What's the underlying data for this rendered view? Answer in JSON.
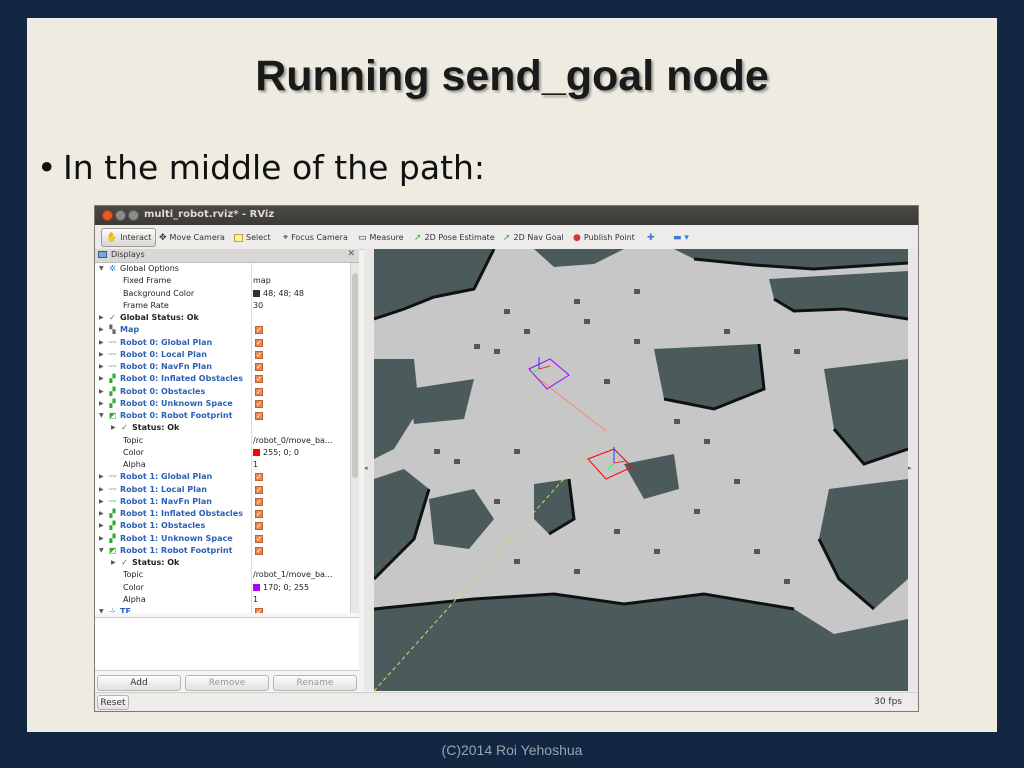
{
  "slide": {
    "title": "Running send_goal node",
    "bullet": "In the middle of the path:",
    "footer": "(C)2014 Roi Yehoshua"
  },
  "window": {
    "title": "multi_robot.rviz* - RViz"
  },
  "toolbar": {
    "interact": "Interact",
    "move_camera": "Move Camera",
    "select": "Select",
    "focus_camera": "Focus Camera",
    "measure": "Measure",
    "pose_estimate": "2D Pose Estimate",
    "nav_goal": "2D Nav Goal",
    "publish_point": "Publish Point"
  },
  "displays": {
    "title": "Displays",
    "rows": [
      {
        "name": "Global Options",
        "style": "normal"
      },
      {
        "name": "Fixed Frame",
        "value": "map"
      },
      {
        "name": "Background Color",
        "value": "48; 48; 48"
      },
      {
        "name": "Frame Rate",
        "value": "30"
      },
      {
        "name": "Global Status: Ok",
        "style": "bold"
      },
      {
        "name": "Map"
      },
      {
        "name": "Robot 0: Global Plan"
      },
      {
        "name": "Robot 0: Local Plan"
      },
      {
        "name": "Robot 0: NavFn Plan"
      },
      {
        "name": "Robot 0: Inflated Obstacles"
      },
      {
        "name": "Robot 0: Obstacles"
      },
      {
        "name": "Robot 0: Unknown Space"
      },
      {
        "name": "Robot 0: Robot Footprint"
      },
      {
        "name": "Status: Ok"
      },
      {
        "name": "Topic",
        "value": "/robot_0/move_ba..."
      },
      {
        "name": "Color",
        "value": "255; 0; 0"
      },
      {
        "name": "Alpha",
        "value": "1"
      },
      {
        "name": "Robot 1: Global Plan"
      },
      {
        "name": "Robot 1: Local Plan"
      },
      {
        "name": "Robot 1: NavFn Plan"
      },
      {
        "name": "Robot 1: Inflated Obstacles"
      },
      {
        "name": "Robot 1: Obstacles"
      },
      {
        "name": "Robot 1: Unknown Space"
      },
      {
        "name": "Robot 1: Robot Footprint"
      },
      {
        "name": "Status: Ok"
      },
      {
        "name": "Topic",
        "value": "/robot_1/move_ba..."
      },
      {
        "name": "Color",
        "value": "170; 0; 255"
      },
      {
        "name": "Alpha",
        "value": "1"
      },
      {
        "name": "TF"
      }
    ],
    "add": "Add",
    "remove": "Remove",
    "rename": "Rename"
  },
  "statusbar": {
    "reset": "Reset",
    "fps": "30 fps"
  },
  "colors": {
    "background_swatch": "#303030",
    "robot0_footprint": "#ff0000",
    "robot1_footprint": "#aa00ff",
    "map_free": "#c7c7c7",
    "map_occupied": "#4a5a5a",
    "map_obstacle": "#111111"
  }
}
